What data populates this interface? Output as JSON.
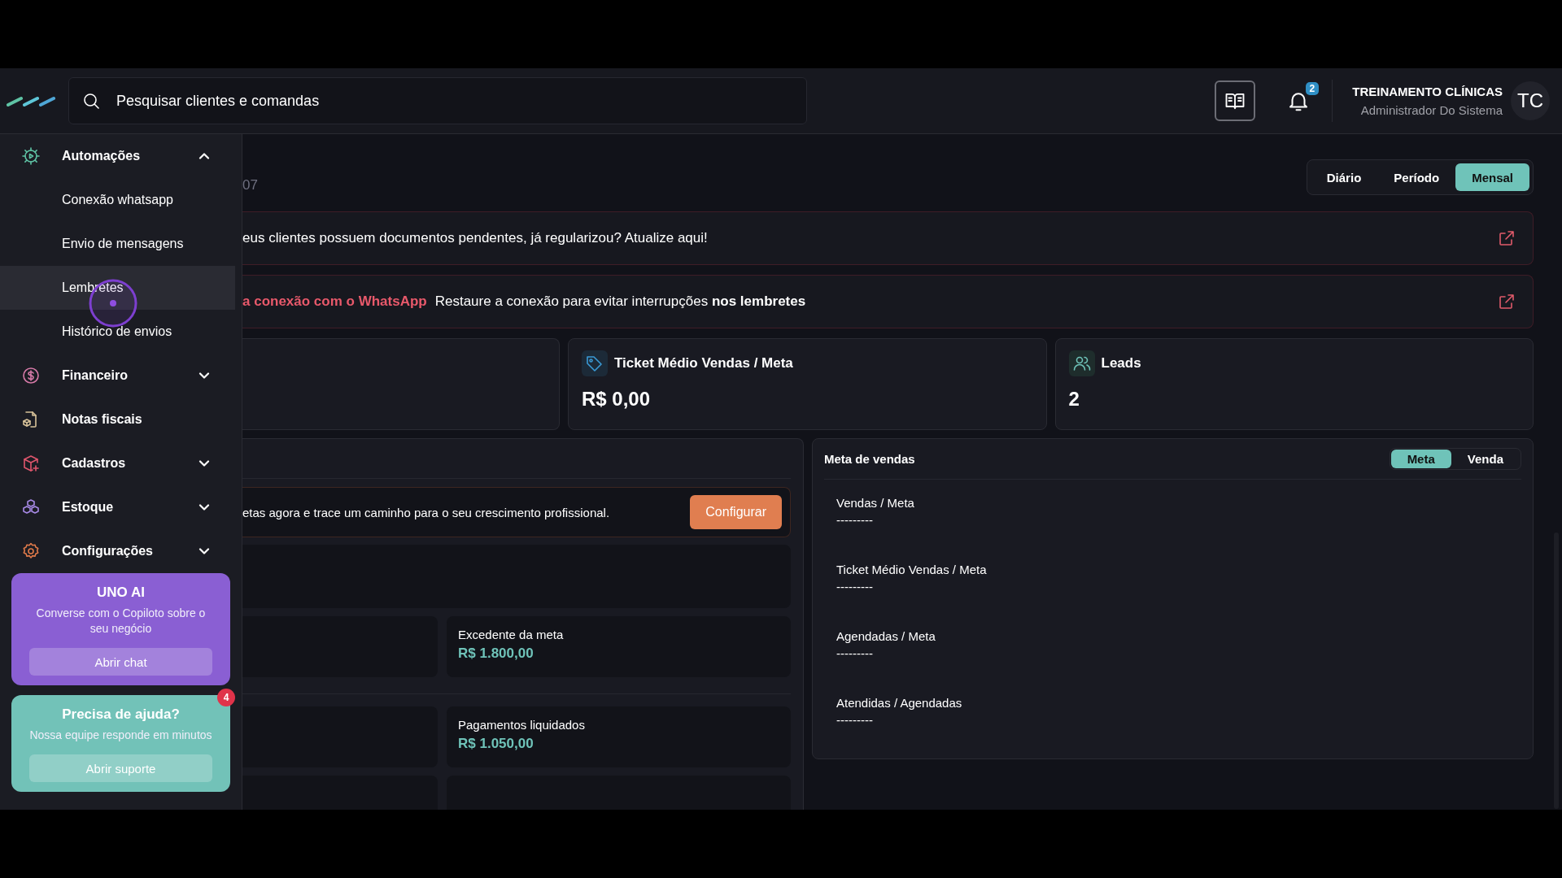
{
  "topbar": {
    "search": {
      "placeholder": "Pesquisar clientes e comandas"
    },
    "notifications": {
      "count": "2"
    },
    "user": {
      "name": "TREINAMENTO CLÍNICAS",
      "role": "Administrador Do Sistema",
      "initials": "TC"
    }
  },
  "sidebar": {
    "items": [
      {
        "label": "Automações",
        "kind": "group",
        "expanded": true,
        "children": [
          {
            "label": "Conexão whatsapp",
            "selected": false
          },
          {
            "label": "Envio de mensagens",
            "selected": false
          },
          {
            "label": "Lembretes",
            "selected": true
          },
          {
            "label": "Histórico de envios",
            "selected": false
          }
        ]
      },
      {
        "label": "Financeiro",
        "kind": "group",
        "expanded": false
      },
      {
        "label": "Notas fiscais",
        "kind": "link"
      },
      {
        "label": "Cadastros",
        "kind": "group",
        "expanded": false
      },
      {
        "label": "Estoque",
        "kind": "group",
        "expanded": false
      },
      {
        "label": "Configurações",
        "kind": "group",
        "expanded": false
      }
    ],
    "promo_cards": [
      {
        "title": "UNO AI",
        "text": "Converse com o Copiloto sobre o seu negócio",
        "button": "Abrir chat",
        "color": "#8a5fd3"
      },
      {
        "title": "Precisa de ajuda?",
        "text": "Nossa equipe responde em minutos",
        "button": "Abrir suporte",
        "badge": "4",
        "color": "#72c2b8"
      }
    ]
  },
  "main": {
    "date_fragment": "07",
    "period_tabs": [
      {
        "label": "Diário",
        "selected": false
      },
      {
        "label": "Período",
        "selected": false
      },
      {
        "label": "Mensal",
        "selected": true
      }
    ],
    "alerts": [
      {
        "kind": "plain",
        "text": "eus clientes possuem documentos pendentes, já regularizou? Atualize aqui!"
      },
      {
        "kind": "titled",
        "title": "a conexão com o WhatsApp",
        "text": "Restaure a conexão para evitar interrupções **nos lembretes**"
      }
    ],
    "stat_cards": [
      {
        "kind": "ticket",
        "title": "Ticket Médio Vendas / Meta",
        "value": "R$ 0,00"
      },
      {
        "kind": "leads",
        "title": "Leads",
        "value": "2"
      }
    ],
    "goals_panel": {
      "banner": {
        "text": "etas agora e trace um caminho para o seu crescimento profissional.",
        "button": "Configurar"
      },
      "metrics": [
        {
          "label": "Excedente da meta",
          "value": "R$ 1.800,00"
        },
        {
          "label": "Pagamentos liquidados",
          "value": "R$ 1.050,00"
        }
      ]
    },
    "sales_goal": {
      "title": "Meta de vendas",
      "tabs": [
        {
          "label": "Meta",
          "selected": true
        },
        {
          "label": "Venda",
          "selected": false
        }
      ],
      "rows": [
        {
          "label": "Vendas / Meta",
          "value": "---------"
        },
        {
          "label": "Ticket Médio Vendas / Meta",
          "value": "---------"
        },
        {
          "label": "Agendadas / Meta",
          "value": "---------"
        },
        {
          "label": "Atendidas / Agendadas",
          "value": "---------"
        }
      ]
    }
  }
}
